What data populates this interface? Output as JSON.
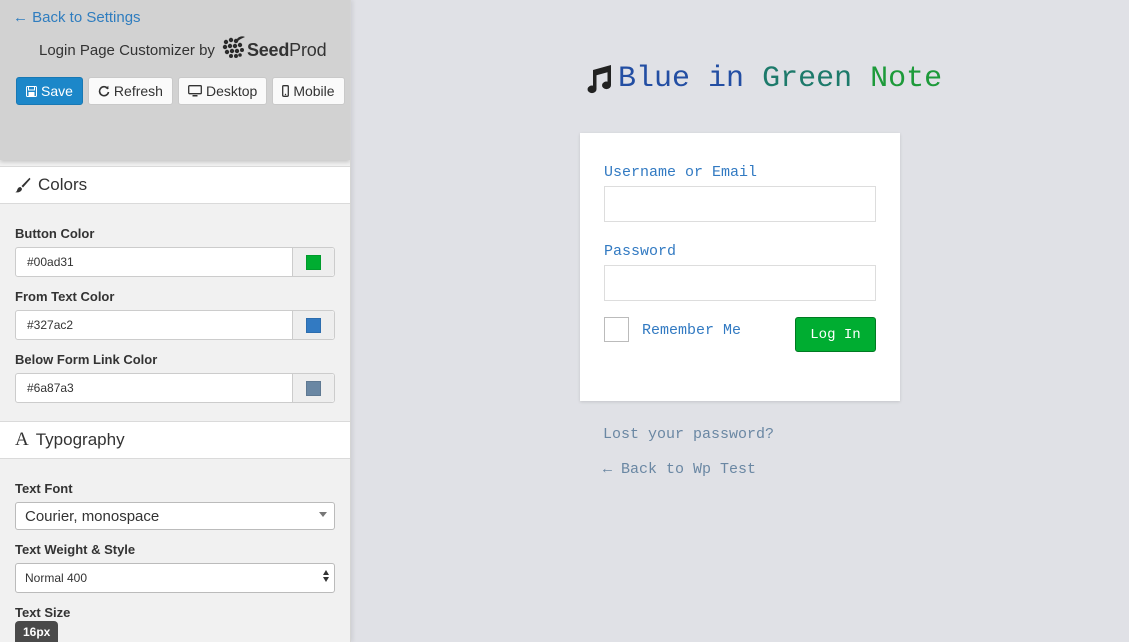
{
  "sidebar": {
    "back_link": "← Back to Settings",
    "customizer_prefix": "Login Page Customizer by",
    "logo_text_bold": "Seed",
    "logo_text_rest": "Prod",
    "toolbar": {
      "save": "Save",
      "refresh": "Refresh",
      "desktop": "Desktop",
      "mobile": "Mobile"
    },
    "colors_section": {
      "title": "Colors",
      "button_color": {
        "label": "Button Color",
        "value": "#00ad31"
      },
      "form_text_color": {
        "label": "From Text Color",
        "value": "#327ac2"
      },
      "below_form_link_color": {
        "label": "Below Form Link Color",
        "value": "#6a87a3"
      }
    },
    "typography_section": {
      "title": "Typography",
      "text_font": {
        "label": "Text Font",
        "value": "Courier, monospace"
      },
      "text_weight": {
        "label": "Text Weight & Style",
        "value": "Normal 400"
      },
      "text_size": {
        "label": "Text Size",
        "value": "16px"
      }
    }
  },
  "preview": {
    "site_title": {
      "word1": "Blue",
      "word2": "in",
      "word3": "Green",
      "word4": "Note"
    },
    "form": {
      "username_label": "Username or Email",
      "username_value": "",
      "password_label": "Password",
      "password_value": "",
      "remember_label": "Remember Me",
      "login_button": "Log In"
    },
    "lost_password": "Lost your password?",
    "back_to_site": "← Back to Wp Test"
  },
  "colors": {
    "accent_save": "#1c87c9",
    "login_button": "#00ad31",
    "form_text": "#327ac2",
    "below_link": "#6a87a3"
  },
  "icons": [
    "save-icon",
    "refresh-icon",
    "desktop-icon",
    "mobile-icon",
    "paintbrush-icon",
    "typography-icon",
    "music-note-icon",
    "seedprod-logo-icon"
  ]
}
